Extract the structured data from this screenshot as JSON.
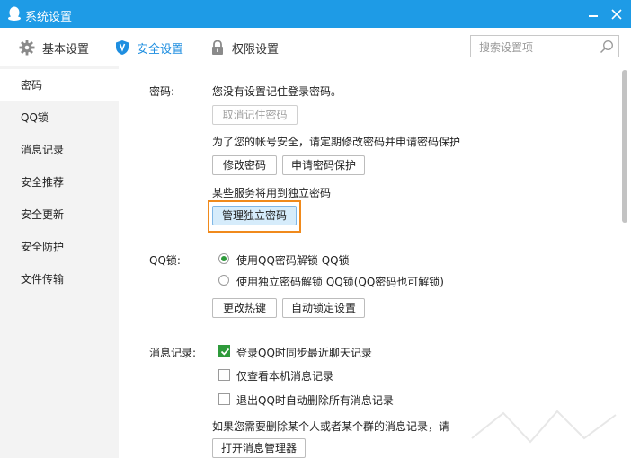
{
  "window": {
    "title": "系统设置"
  },
  "toolbar": {
    "tabs": [
      {
        "label": "基本设置",
        "icon": "gear-icon"
      },
      {
        "label": "安全设置",
        "icon": "shield-icon",
        "active": true
      },
      {
        "label": "权限设置",
        "icon": "lock-icon"
      }
    ],
    "search_placeholder": "搜索设置项"
  },
  "sidebar": {
    "items": [
      {
        "label": "密码",
        "active": true
      },
      {
        "label": "QQ锁"
      },
      {
        "label": "消息记录"
      },
      {
        "label": "安全推荐"
      },
      {
        "label": "安全更新"
      },
      {
        "label": "安全防护"
      },
      {
        "label": "文件传输"
      }
    ]
  },
  "password": {
    "label": "密码:",
    "no_saved_text": "您没有设置记住登录密码。",
    "cancel_remember_label": "取消记住密码",
    "hint_text": "为了您的帐号安全，请定期修改密码并申请密码保护",
    "change_label": "修改密码",
    "protect_label": "申请密码保护",
    "independent_text": "某些服务将用到独立密码",
    "manage_independent_label": "管理独立密码"
  },
  "qqlock": {
    "label": "QQ锁:",
    "option1": "使用QQ密码解锁 QQ锁",
    "option2": "使用独立密码解锁 QQ锁(QQ密码也可解锁)",
    "hotkey_label": "更改热键",
    "autolock_label": "自动锁定设置"
  },
  "messages": {
    "label": "消息记录:",
    "opt1": "登录QQ时同步最近聊天记录",
    "opt2": "仅查看本机消息记录",
    "opt3": "退出QQ时自动删除所有消息记录",
    "delete_hint": "如果您需要删除某个人或者某个群的消息记录，请",
    "open_manager_label": "打开消息管理器"
  },
  "colors": {
    "accent": "#1e9be6",
    "highlight_border": "#f08a1c",
    "check_green": "#2e9a3b"
  }
}
